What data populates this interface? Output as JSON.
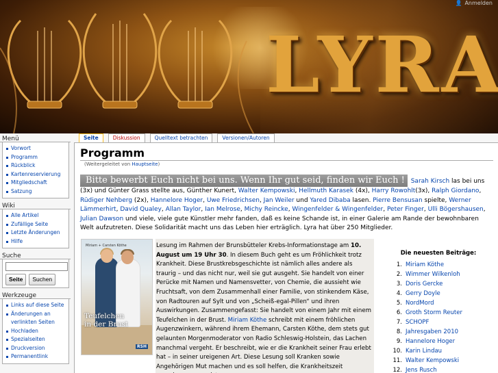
{
  "header": {
    "logo_text": "LYRA",
    "login_label": "Anmelden"
  },
  "sidebar": {
    "menu": {
      "title": "Menü",
      "items": [
        "Vorwort",
        "Programm",
        "Rückblick",
        "Kartenreservierung",
        "Mitgliedschaft",
        "Satzung"
      ]
    },
    "wiki": {
      "title": "Wiki",
      "items": [
        "Alle Artikel",
        "Zufällige Seite",
        "Letzte Änderungen",
        "Hilfe"
      ]
    },
    "search": {
      "title": "Suche",
      "placeholder": "",
      "go_label": "Seite",
      "search_label": "Suchen"
    },
    "tools": {
      "title": "Werkzeuge",
      "items": [
        "Links auf diese Seite",
        "Änderungen an verlinkten Seiten",
        "Hochladen",
        "Spezialseiten",
        "Druckversion",
        "Permanentlink"
      ]
    }
  },
  "tabs": [
    "Seite",
    "Diskussion",
    "Quelltext betrachten",
    "Versionen/Autoren"
  ],
  "page": {
    "title": "Programm",
    "redirect_prefix": "(Weitergeleitet von ",
    "redirect_link": "Hauptseite",
    "redirect_suffix": ")",
    "quote": "Bitte bewerbt Euch nicht bei uns. Wenn Ihr gut seid, finden wir Euch !",
    "intro": {
      "p1": "Sarah Kirsch",
      "t1": " las bei uns (3x) und Günter Grass stellte aus, Günther Kunert, ",
      "l1": "Walter Kempowski",
      "t2": ", ",
      "l2": "Hellmuth Karasek",
      "t3": " (4x), ",
      "l3": "Harry Rowohlt",
      "t4": "(3x), ",
      "l4": "Ralph Giordano",
      "t5": ", ",
      "l5": "Rüdiger Nehberg",
      "t6": " (2x), ",
      "l6": "Hannelore Hoger",
      "t7": ", ",
      "l7": "Uwe Friedrichsen",
      "t8": ", ",
      "l8": "Jan Weiler",
      "t9": " und ",
      "l9": "Yared Dibaba",
      "t10": " lasen. ",
      "l10": "Pierre Bensusan",
      "t11": " spielte, ",
      "l11": "Werner Lämmerhirt",
      "t12": ", ",
      "l12": "David Qualey",
      "t13": ", ",
      "l13": "Allan Taylor",
      "t14": ", ",
      "l14": "Ian Melrose",
      "t15": ", ",
      "l15": "Michy Reincke",
      "t16": ", ",
      "l16": "Wingenfelder & Wingenfelder",
      "t17": ", ",
      "l17": "Peter Finger",
      "t18": ", ",
      "l18": "Ulli Bögershausen",
      "t19": ", ",
      "l19": "Julian Dawson",
      "t20": " und viele, viele gute Künstler mehr fanden, daß es keine Schande ist, in einer Galerie am Rande der bewohnbaren Welt aufzutreten. Diese Solidarität macht uns das Leben hier erträglich. Lyra hat über 250 Mitglieder."
    },
    "book": {
      "authors": "Miriam + Carsten Köthe",
      "title_line1": "Teufelchen",
      "title_line2": "in der Brust",
      "publisher": "RSH"
    },
    "event": {
      "t1": "Lesung im Rahmen der Brunsbütteler Krebs-Informationstage am ",
      "date": "10. August um 19 Uhr 30",
      "t2": ". In diesem Buch geht es um Fröhlichkeit trotz Krankheit. Diese Brustkrebsgeschichte ist nämlich alles andere als traurig – und das nicht nur, weil sie gut ausgeht. Sie handelt von einer Perücke mit Namen und Namensvetter, von Chemie, die aussieht wie Fruchtsaft, von dem Zusammenhall einer Familie, von stinkendem Käse, von Radtouren auf Sylt und von „Scheiß-egal-Pillen“ und ihren Auswirkungen. Zusammengefasst: Sie handelt von einem Jahr mit einem Teufelchen in der Brust. ",
      "link": "Miriam Köthe",
      "t3": " schreibt mit einem fröhlichen Augenzwinkern, während ihrem Ehemann, Carsten Köthe, dem stets gut gelaunten Morgenmoderator von Radio Schleswig-Holstein, das Lachen manchmal vergeht. Er beschreibt, wie er die Krankheit seiner Frau erlebt hat – in seiner ureigenen Art. Diese Lesung soll Kranken sowie Angehörigen Mut machen und es soll helfen, die Krankheitszeit gemeinsam zu meistern."
    },
    "recent": {
      "title": "Die neuesten Beiträge:",
      "items": [
        {
          "num": "1.",
          "label": "Miriam Köthe"
        },
        {
          "num": "2.",
          "label": "Wimmer Wilkenloh"
        },
        {
          "num": "3.",
          "label": "Doris Gercke"
        },
        {
          "num": "4.",
          "label": "Gerry Doyle"
        },
        {
          "num": "5.",
          "label": "NordMord"
        },
        {
          "num": "6.",
          "label": "Groth Storm Reuter"
        },
        {
          "num": "7.",
          "label": "SCHOPF"
        },
        {
          "num": "8.",
          "label": "Jahresgaben 2010"
        },
        {
          "num": "9.",
          "label": "Hannelore Hoger"
        },
        {
          "num": "10.",
          "label": "Karin Lindau"
        },
        {
          "num": "11.",
          "label": "Walter Kempowski"
        },
        {
          "num": "12.",
          "label": "Jens Rusch"
        }
      ]
    }
  },
  "colors": {
    "link": "#0645ad",
    "new_link": "#ba0000",
    "tab_selected_border": "#fabd23",
    "logo_gold": "#e2a33c"
  }
}
